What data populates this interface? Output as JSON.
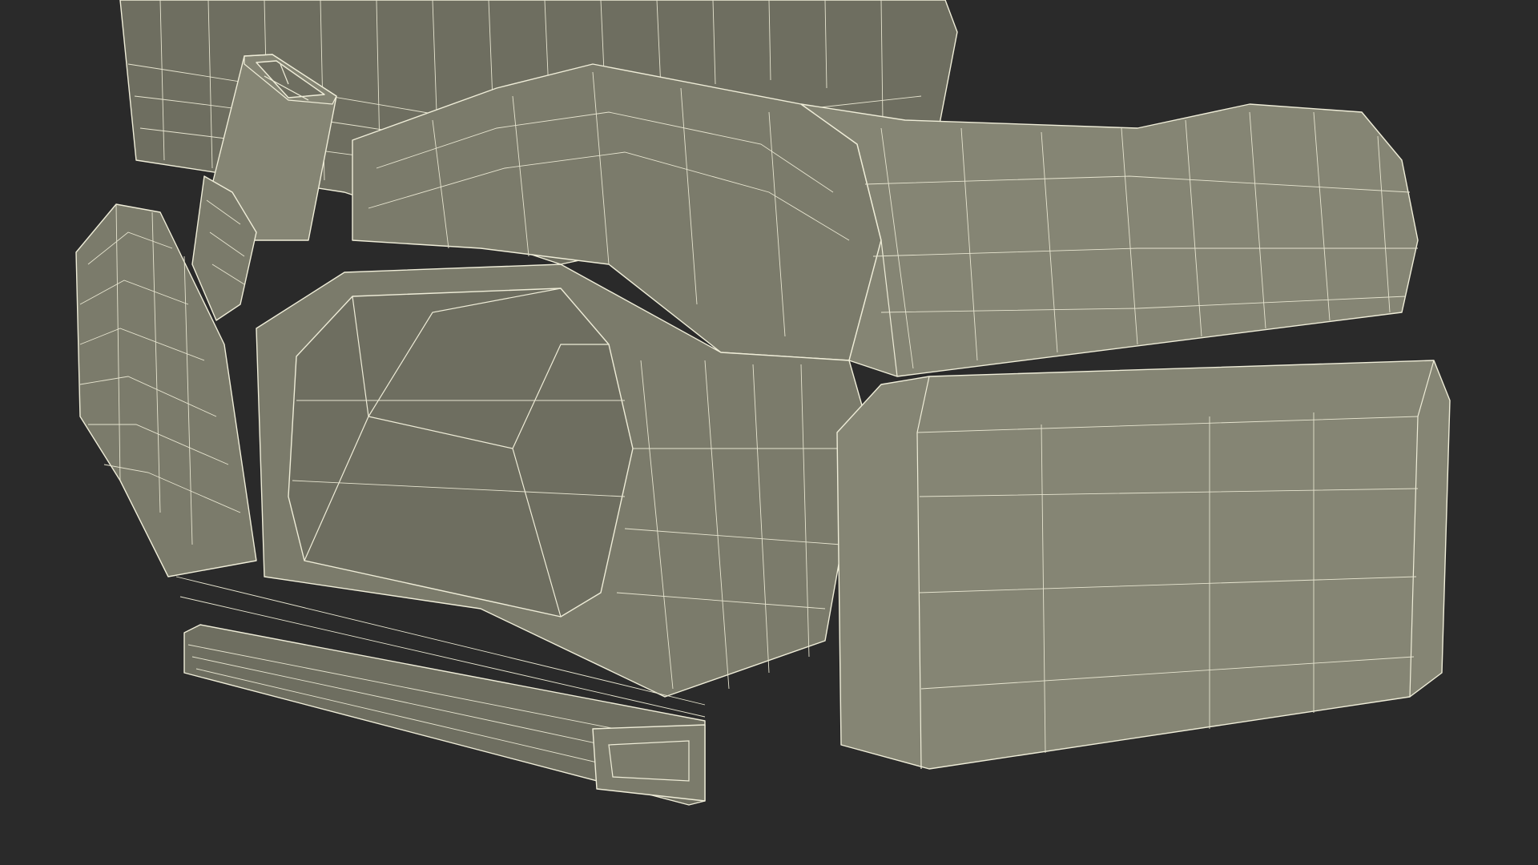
{
  "scene": {
    "background_color": "#2a2a2a",
    "mesh_color": "#7b7b6b",
    "wire_color": "#efedd8"
  }
}
